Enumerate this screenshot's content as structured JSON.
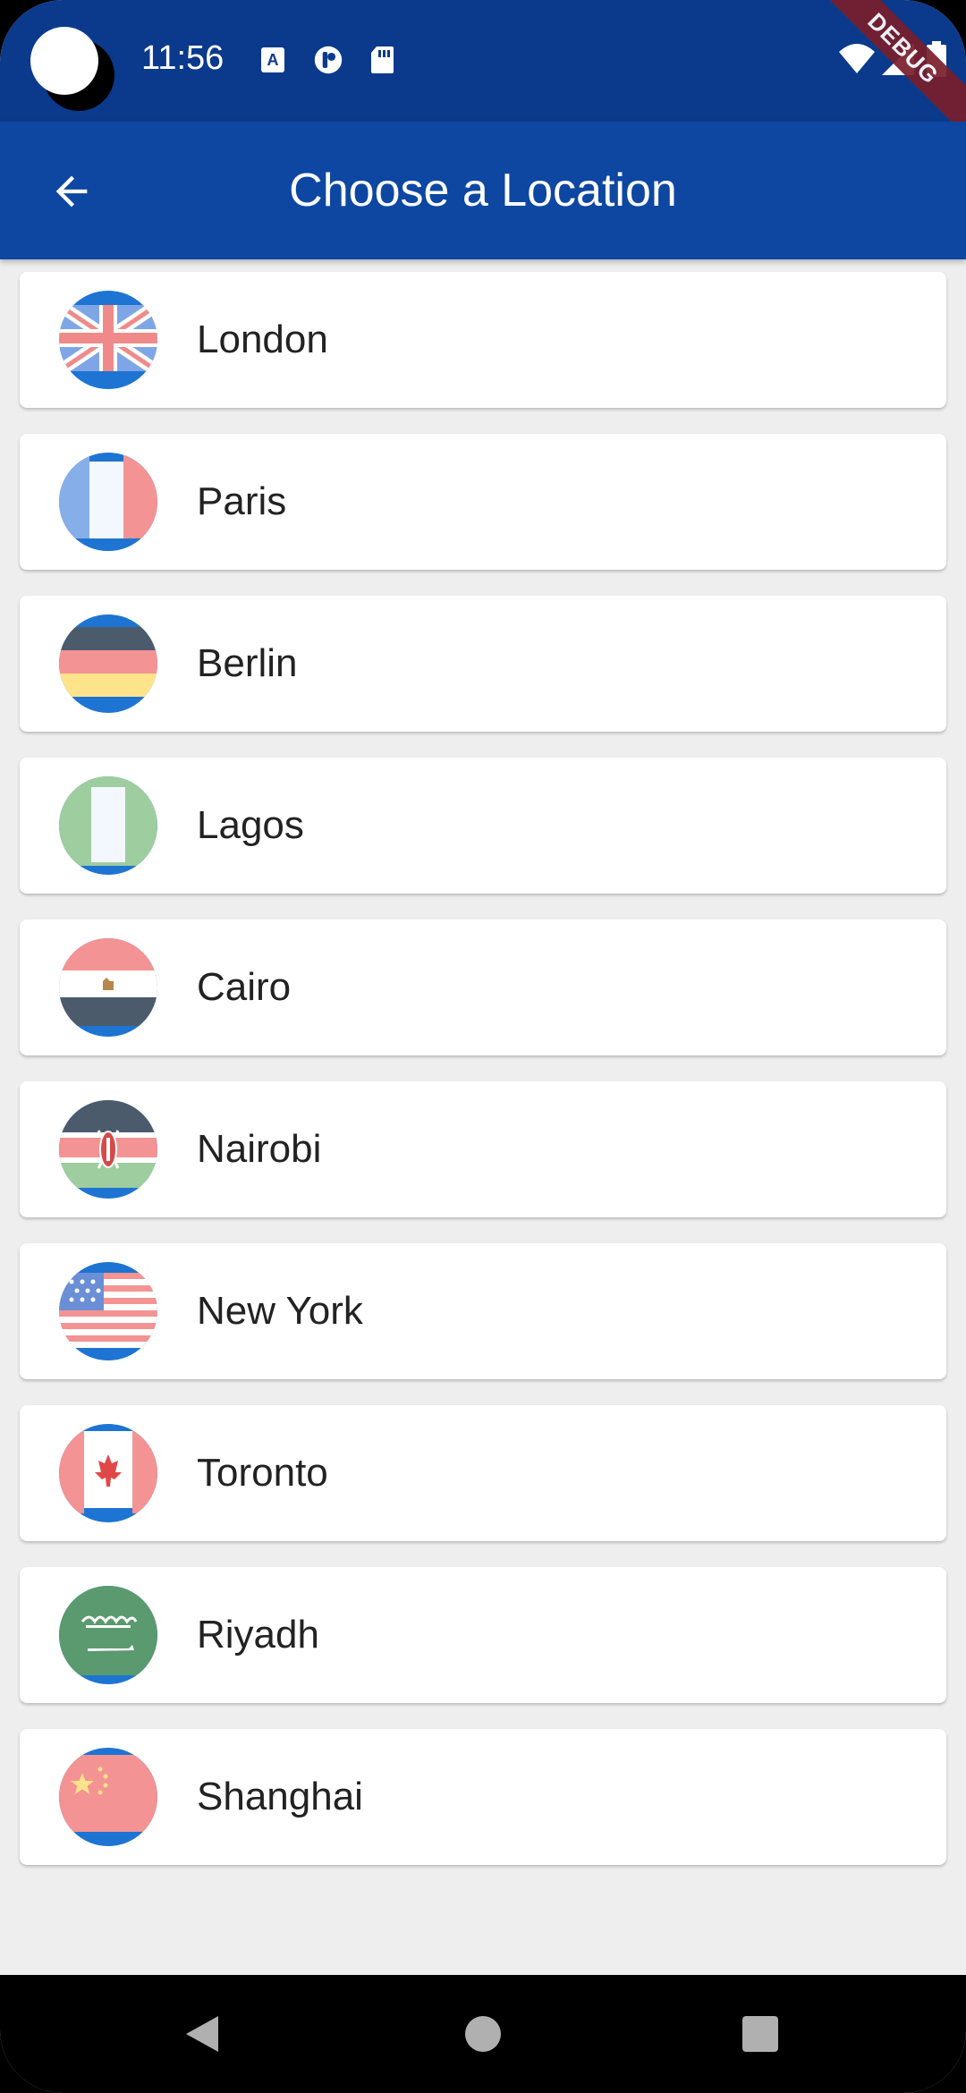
{
  "status_bar": {
    "time": "11:56",
    "debug_label": "DEBUG",
    "icons": [
      "notification-a-icon",
      "notification-p-icon",
      "sd-card-icon",
      "wifi-icon",
      "signal-icon",
      "battery-icon"
    ]
  },
  "app_bar": {
    "title": "Choose a Location",
    "back_icon": "arrow-back-icon"
  },
  "locations": [
    {
      "city": "London",
      "flag": "uk-flag-icon"
    },
    {
      "city": "Paris",
      "flag": "france-flag-icon"
    },
    {
      "city": "Berlin",
      "flag": "germany-flag-icon"
    },
    {
      "city": "Lagos",
      "flag": "nigeria-flag-icon"
    },
    {
      "city": "Cairo",
      "flag": "egypt-flag-icon"
    },
    {
      "city": "Nairobi",
      "flag": "kenya-flag-icon"
    },
    {
      "city": "New York",
      "flag": "usa-flag-icon"
    },
    {
      "city": "Toronto",
      "flag": "canada-flag-icon"
    },
    {
      "city": "Riyadh",
      "flag": "saudi-arabia-flag-icon"
    },
    {
      "city": "Shanghai",
      "flag": "china-flag-icon"
    }
  ],
  "nav_bar": {
    "icons": [
      "nav-back-icon",
      "nav-home-icon",
      "nav-recents-icon"
    ]
  },
  "colors": {
    "status_bar": "#0b3a8c",
    "app_bar": "#0d47a1",
    "background": "#eeeeee",
    "card": "#ffffff",
    "flag_ring": "#1e74d2"
  }
}
